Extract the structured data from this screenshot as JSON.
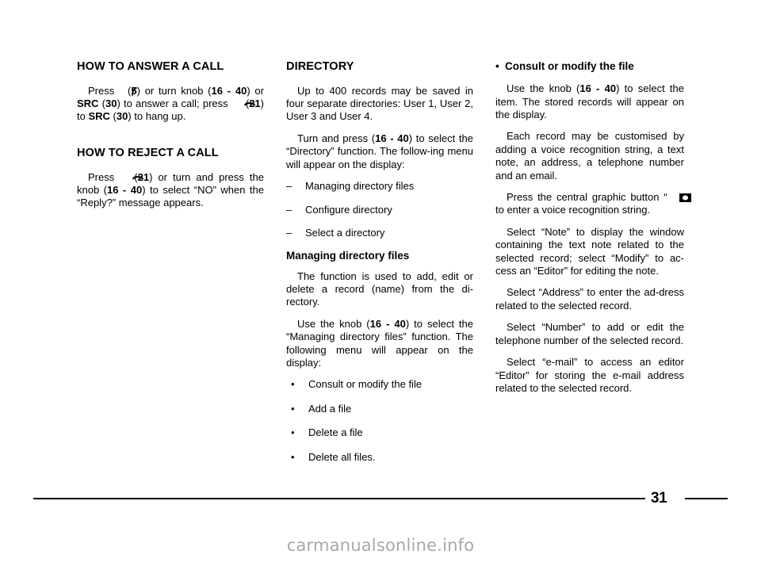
{
  "page": {
    "number": "31",
    "watermark": "carmanualsonline.info"
  },
  "columns": {
    "left": {
      "section1": {
        "heading": "HOW TO ANSWER A CALL",
        "para1_a": "Press",
        "para1_icon1": "pickup-phone-icon",
        "para1_b": "(",
        "para1_ref1": "5",
        "para1_c": ") or turn knob (",
        "para1_ref2": "16 - 40",
        "para1_d": ") or ",
        "para1_src1": "SRC",
        "para1_e": " (",
        "para1_ref3": "30",
        "para1_f": ") to answer a call; press",
        "para1_icon2": "hangup-phone-icon",
        "para1_g": "(",
        "para1_ref4": "21",
        "para1_h": ") to ",
        "para1_src2": "SRC",
        "para1_i": " (",
        "para1_ref5": "30",
        "para1_j": ") to hang up."
      },
      "section2": {
        "heading": "HOW TO REJECT A CALL",
        "para1_a": "Press",
        "para1_icon1": "hangup-phone-icon",
        "para1_b": "(",
        "para1_ref1": "21",
        "para1_c": ") or turn and press the knob (",
        "para1_ref2": "16 - 40",
        "para1_d": ") to select “NO” when the “Reply?” message appears."
      }
    },
    "middle": {
      "heading": "DIRECTORY",
      "para1": "Up to 400 records may be saved in four separate directories: User 1, User 2, User 3 and User 4.",
      "para2_a": "Turn and press (",
      "para2_ref": "16 - 40",
      "para2_b": ") to select the “Directory” function. The follow-ing menu will appear on the display:",
      "menu_items": [
        "Managing directory files",
        "Configure directory",
        "Select a directory"
      ],
      "subheading": "Managing directory files",
      "para3": "The function is used to add, edit or delete a record (name) from the di-rectory.",
      "para4_a": "Use the knob (",
      "para4_ref": "16 - 40",
      "para4_b": ") to select the “Managing directory files” function. The following menu will appear on the display:",
      "bullets": [
        "Consult or modify the file",
        "Add a file",
        "Delete a file",
        "Delete all files."
      ]
    },
    "right": {
      "bullet_heading": "Consult or modify the file",
      "bullet_marker": "•",
      "para1_a": "Use the knob (",
      "para1_ref": "16 - 40",
      "para1_b": ") to select the item. The stored records will appear on the display.",
      "para2": "Each record may be customised by adding a voice recognition string, a text note, an address, a telephone number and an email.",
      "para3_a": "Press the central graphic button “",
      "para3_icon": "central-graphic-button-icon",
      "para3_b": "” to enter a voice recognition string.",
      "para4": "Select “Note” to display the window containing the text note related to the selected record; select “Modify” to ac-cess an “Editor” for editing the note.",
      "para5": "Select “Address” to enter the ad-dress related to the selected record.",
      "para6": "Select “Number” to add or edit the telephone number of the selected record.",
      "para7": "Select “e-mail” to access an editor “Editor” for storing the e-mail address related to the selected record."
    }
  },
  "markers": {
    "dash": "–",
    "dot": "•"
  },
  "colors": {
    "text": "#000000",
    "background": "#ffffff",
    "watermark": "#a8a8a8"
  }
}
